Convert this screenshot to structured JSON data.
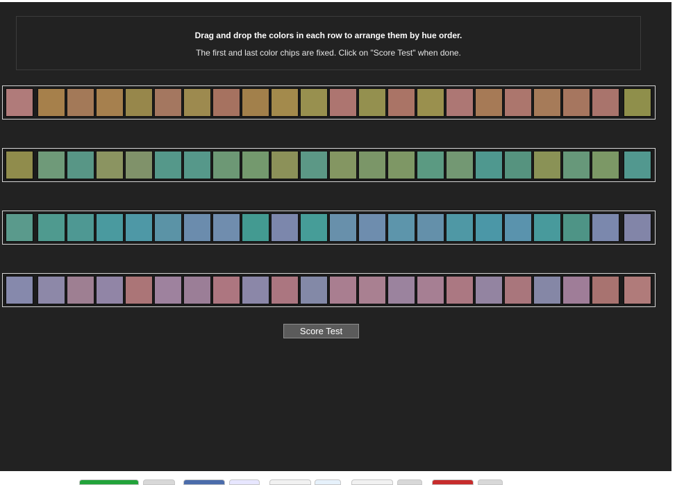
{
  "instructions": {
    "title": "Drag and drop the colors in each row to arrange them by hue order.",
    "subtitle": "The first and last color chips are fixed. Click on \"Score Test\" when done."
  },
  "score_button": {
    "label": "Score Test"
  },
  "rows": [
    [
      "#b07b7a",
      "#a6804b",
      "#a37958",
      "#a6804e",
      "#97874b",
      "#a47760",
      "#9d8a4f",
      "#a67260",
      "#a2804b",
      "#a38a4c",
      "#98904f",
      "#ad7570",
      "#94904f",
      "#aa7466",
      "#9a904e",
      "#ad7774",
      "#a67a56",
      "#ac766d",
      "#a67b59",
      "#a6765f",
      "#a9746c",
      "#8f8f4b"
    ],
    [
      "#908c4c",
      "#6f9a79",
      "#589686",
      "#8b9461",
      "#80926a",
      "#55988a",
      "#56988a",
      "#6d9875",
      "#74996e",
      "#8c9159",
      "#5c9886",
      "#849662",
      "#7b9668",
      "#7e9765",
      "#5b9a82",
      "#739873",
      "#4f988f",
      "#56937f",
      "#8a9256",
      "#67987a",
      "#7c9866",
      "#52988f"
    ],
    [
      "#5a9a8c",
      "#4f9a8f",
      "#4e9893",
      "#4a9a9f",
      "#4e98a6",
      "#5b93a6",
      "#6b8cad",
      "#708dae",
      "#439a91",
      "#7c87ac",
      "#469d98",
      "#6890ab",
      "#6e8dae",
      "#5d95ab",
      "#6490aa",
      "#4f98a5",
      "#4b97a7",
      "#5a93ad",
      "#489a9c",
      "#4e9486",
      "#7b88ad",
      "#8285a8"
    ],
    [
      "#8689ac",
      "#8d88a8",
      "#9e7f92",
      "#9185a6",
      "#ab7577",
      "#9e829e",
      "#9b7e97",
      "#ad7680",
      "#8b87a8",
      "#ab7680",
      "#8389a7",
      "#a97e90",
      "#a98091",
      "#9b839e",
      "#a67f93",
      "#ab7882",
      "#9384a1",
      "#a9767c",
      "#8587a6",
      "#9f7d98",
      "#a87370",
      "#b07b7a"
    ]
  ],
  "share_buttons": [
    {
      "color": "#22a33a"
    },
    {
      "color": "#d8d8d8"
    },
    {
      "color": "#4b6cab"
    },
    {
      "color": "#e7e6ff"
    },
    {
      "color": "#f1f1f1"
    },
    {
      "color": "#e6f1fb"
    },
    {
      "color": "#f1f1f1"
    },
    {
      "color": "#d8d8d8"
    },
    {
      "color": "#c72c2c"
    },
    {
      "color": "#d8d8d8"
    }
  ]
}
